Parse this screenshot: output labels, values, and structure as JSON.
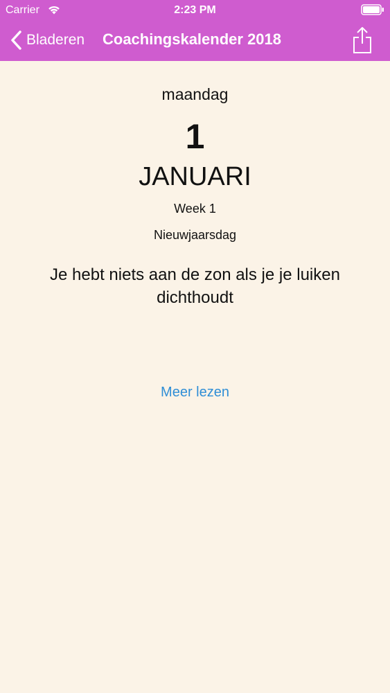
{
  "status_bar": {
    "carrier": "Carrier",
    "time": "2:23 PM"
  },
  "nav": {
    "back_label": "Bladeren",
    "title": "Coachingskalender 2018",
    "back_icon": "chevron-left-icon",
    "share_icon": "share-icon"
  },
  "day": {
    "weekday": "maandag",
    "number": "1",
    "month": "JANUARI",
    "week": "Week 1",
    "holiday": "Nieuwjaarsdag"
  },
  "quote": "Je hebt niets aan de zon als je je luiken dichthoudt",
  "read_more": "Meer lezen",
  "colors": {
    "header": "#cf5ccf",
    "background": "#fbf3e7",
    "link": "#2f8ed6"
  }
}
